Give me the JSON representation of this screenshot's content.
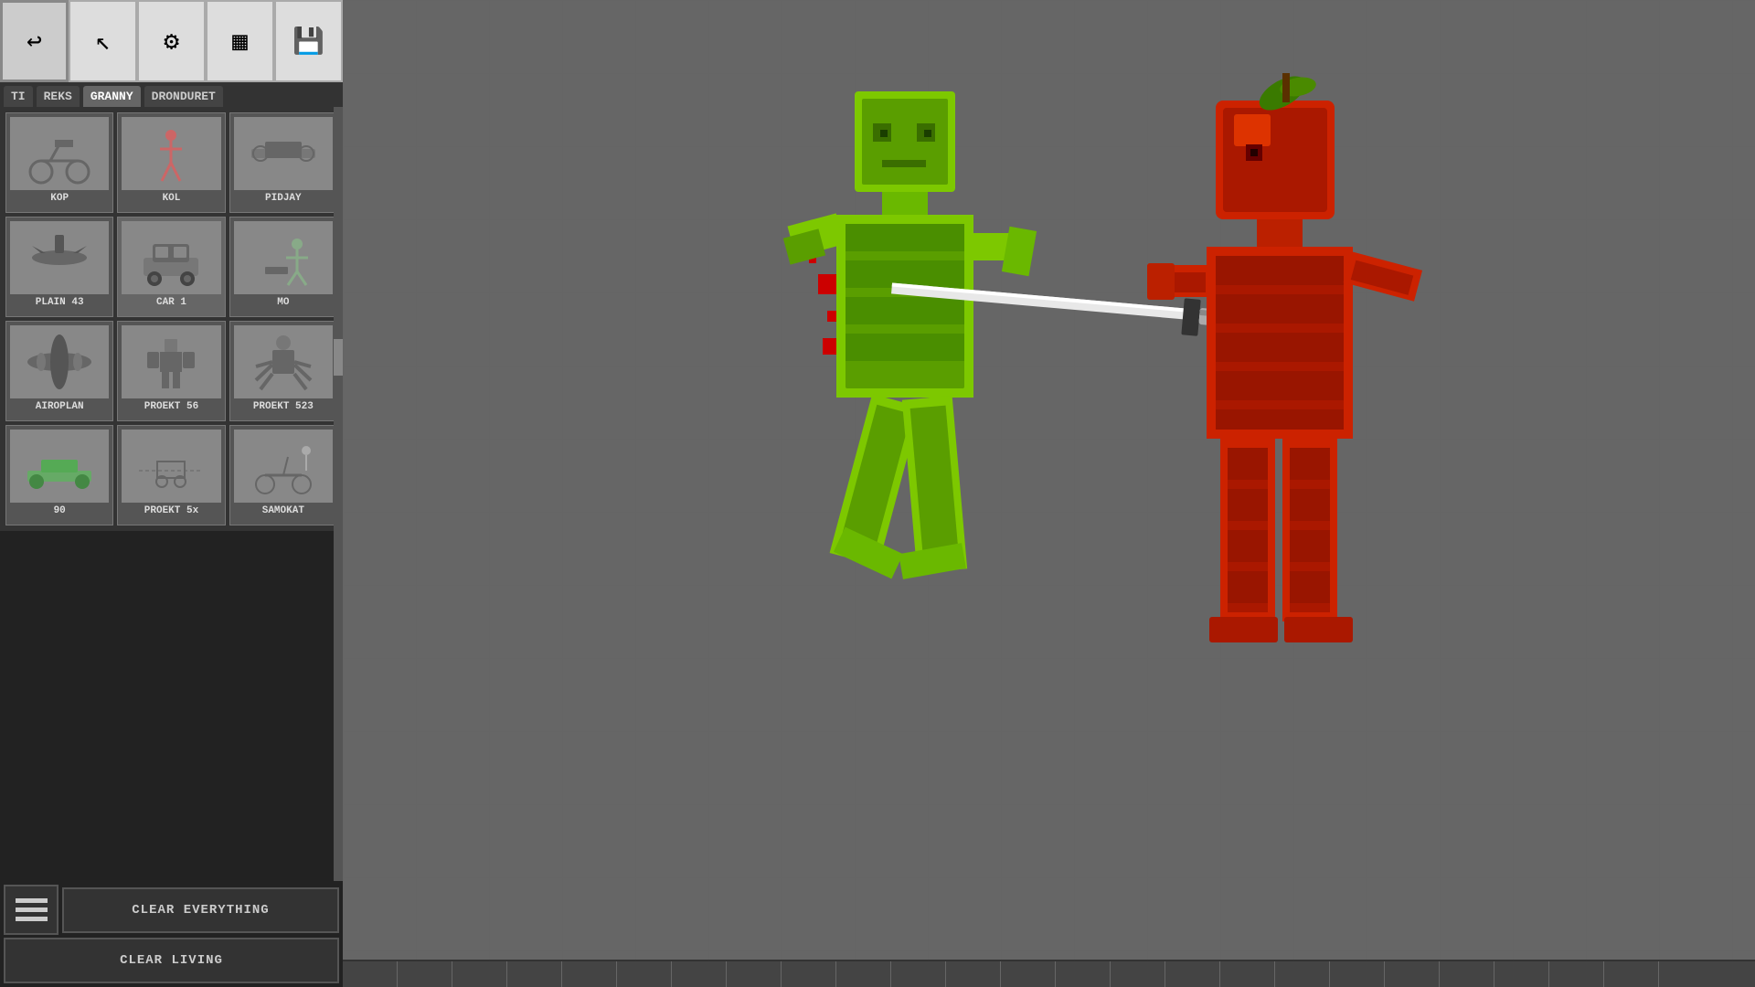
{
  "toolbar": {
    "buttons": [
      {
        "id": "back",
        "icon": "↩",
        "label": "back-button"
      },
      {
        "id": "cursor",
        "icon": "↖",
        "label": "cursor-button"
      },
      {
        "id": "settings",
        "icon": "⚙",
        "label": "settings-button"
      },
      {
        "id": "panels",
        "icon": "▦",
        "label": "panels-button"
      },
      {
        "id": "save",
        "icon": "💾",
        "label": "save-button"
      }
    ]
  },
  "tabs": [
    {
      "id": "ti",
      "label": "TI",
      "active": false
    },
    {
      "id": "reks",
      "label": "REKS",
      "active": false
    },
    {
      "id": "granny",
      "label": "GRANNY",
      "active": true
    },
    {
      "id": "dronduret",
      "label": "DRONDURET",
      "active": false
    }
  ],
  "grid_items": [
    {
      "id": "kop",
      "label": "KOP",
      "row": 0,
      "col": 0
    },
    {
      "id": "kol",
      "label": "KOL",
      "row": 0,
      "col": 1
    },
    {
      "id": "pidjay",
      "label": "PIDJAY",
      "row": 0,
      "col": 2
    },
    {
      "id": "plain43",
      "label": "PLAIN 43",
      "row": 1,
      "col": 0
    },
    {
      "id": "car1",
      "label": "CAR 1",
      "row": 1,
      "col": 1
    },
    {
      "id": "mo",
      "label": "MO",
      "row": 1,
      "col": 2
    },
    {
      "id": "airoplan",
      "label": "AIROPLAN",
      "row": 2,
      "col": 0
    },
    {
      "id": "proekt56",
      "label": "PROEKT 56",
      "row": 2,
      "col": 1
    },
    {
      "id": "proekt523",
      "label": "PROEKT 523",
      "row": 2,
      "col": 2
    },
    {
      "id": "ninety",
      "label": "90",
      "row": 3,
      "col": 0
    },
    {
      "id": "proekt5x",
      "label": "PROEKT 5x",
      "row": 3,
      "col": 1
    },
    {
      "id": "samokat",
      "label": "SAMOKAT",
      "row": 3,
      "col": 2
    }
  ],
  "bottom_buttons": {
    "clear_everything": "CLEAR EVERYTHING",
    "clear_living": "CLEAR LIVING"
  },
  "game": {
    "green_char": "green-character",
    "red_char": "red-apple-character",
    "action": "stabbing"
  }
}
